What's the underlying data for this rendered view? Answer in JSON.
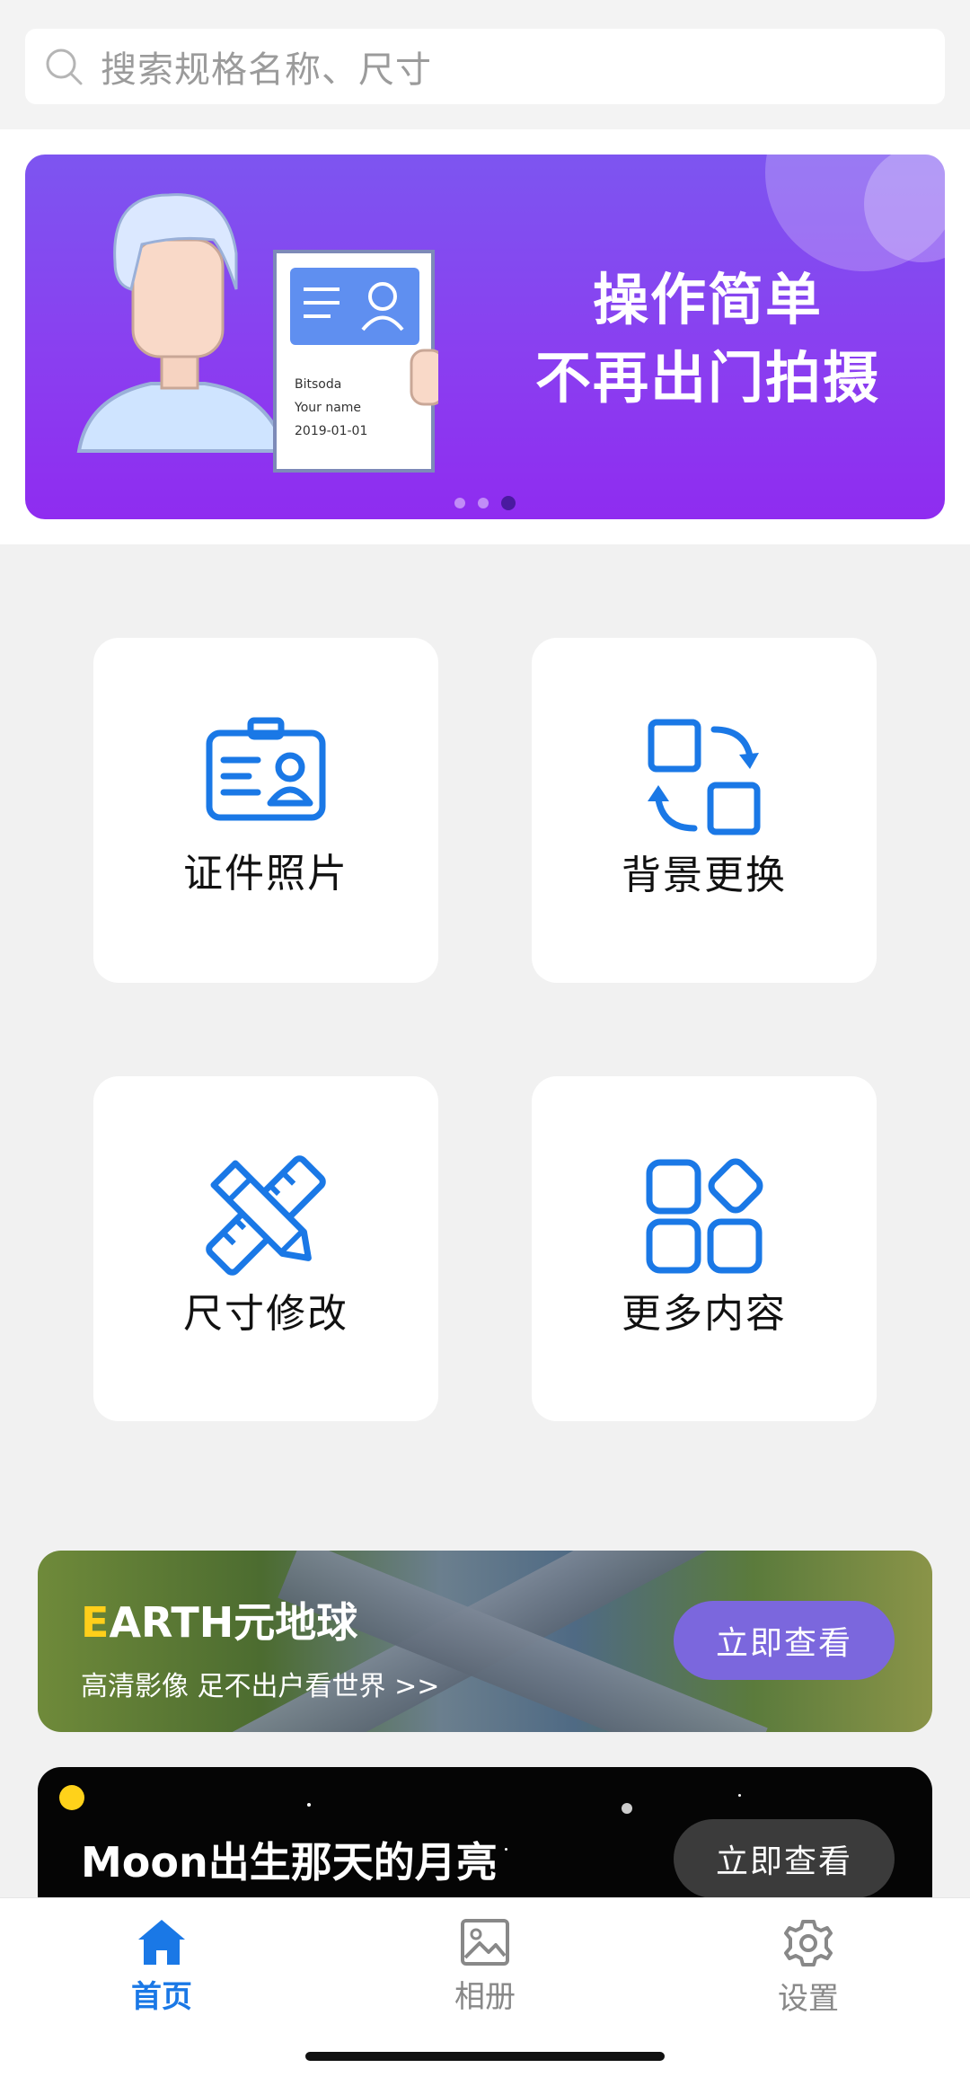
{
  "search": {
    "placeholder": "搜索规格名称、尺寸"
  },
  "banner": {
    "line1": "操作简单",
    "line2": "不再出门拍摄",
    "card": {
      "brand": "Bitsoda",
      "name": "Your name",
      "date": "2019-01-01"
    },
    "dots": 3,
    "active_dot": 3
  },
  "features": [
    {
      "label": "证件照片",
      "icon": "id-card-icon"
    },
    {
      "label": "背景更换",
      "icon": "swap-icon"
    },
    {
      "label": "尺寸修改",
      "icon": "ruler-pencil-icon"
    },
    {
      "label": "更多内容",
      "icon": "apps-grid-icon"
    }
  ],
  "promos": {
    "earth": {
      "title_first": "E",
      "title_rest": "ARTH元地球",
      "subtitle": "高清影像 足不出户看世界 >>",
      "button": "立即查看"
    },
    "moon": {
      "title": "Moon出生那天的月亮",
      "button": "立即查看"
    }
  },
  "nav": [
    {
      "label": "首页",
      "icon": "home-icon",
      "active": true
    },
    {
      "label": "相册",
      "icon": "image-icon",
      "active": false
    },
    {
      "label": "设置",
      "icon": "gear-icon",
      "active": false
    }
  ],
  "colors": {
    "accent": "#1a78e6",
    "banner_start": "#7d55f0",
    "banner_end": "#8f2cf0",
    "earth_button": "#7b67dd"
  }
}
